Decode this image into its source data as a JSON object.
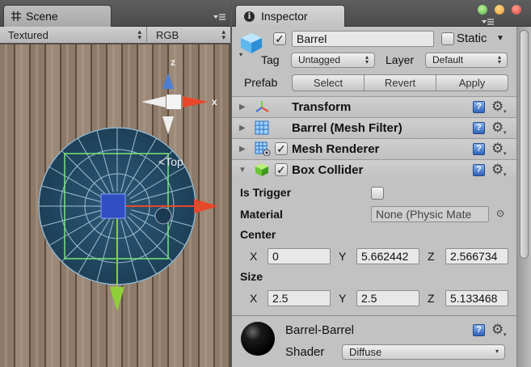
{
  "scene": {
    "tab_label": "Scene",
    "render_mode": "Textured",
    "color_mode": "RGB",
    "gizmo": {
      "top_label": "Top",
      "axis_z": "z",
      "axis_x": "x"
    },
    "icons": {
      "tab": "grid-icon",
      "menu": "tab-menu-icon"
    }
  },
  "inspector": {
    "tab_label": "Inspector",
    "object_name": "Barrel",
    "active": true,
    "static_label": "Static",
    "static": false,
    "tag_label": "Tag",
    "tag_value": "Untagged",
    "layer_label": "Layer",
    "layer_value": "Default",
    "prefab_label": "Prefab",
    "prefab_buttons": [
      "Select",
      "Revert",
      "Apply"
    ],
    "components": [
      {
        "name": "Transform",
        "icon": "transform-axes-icon",
        "expanded": false,
        "has_checkbox": false
      },
      {
        "name": "Barrel (Mesh Filter)",
        "icon": "mesh-filter-icon",
        "expanded": false,
        "has_checkbox": false
      },
      {
        "name": "Mesh Renderer",
        "icon": "mesh-renderer-icon",
        "expanded": false,
        "has_checkbox": true,
        "enabled": true
      },
      {
        "name": "Box Collider",
        "icon": "box-collider-icon",
        "expanded": true,
        "has_checkbox": true,
        "enabled": true
      }
    ],
    "box_collider": {
      "is_trigger_label": "Is Trigger",
      "is_trigger": false,
      "material_label": "Material",
      "material_value": "None (Physic Mate",
      "center_label": "Center",
      "center": {
        "x_label": "X",
        "x": "0",
        "y_label": "Y",
        "y": "5.662442",
        "z_label": "Z",
        "z": "2.566734"
      },
      "size_label": "Size",
      "size": {
        "x_label": "X",
        "x": "2.5",
        "y_label": "Y",
        "y": "2.5",
        "z_label": "Z",
        "z": "5.133468"
      }
    },
    "material": {
      "name": "Barrel-Barrel",
      "shader_label": "Shader",
      "shader_value": "Diffuse"
    },
    "colors": {
      "close": "#d9463b",
      "minimize": "#e89a2a",
      "maximize": "#5fb54a",
      "axis_x": "#e8472a",
      "axis_y": "#8fcf3a",
      "axis_z": "#4a7fd4"
    }
  }
}
